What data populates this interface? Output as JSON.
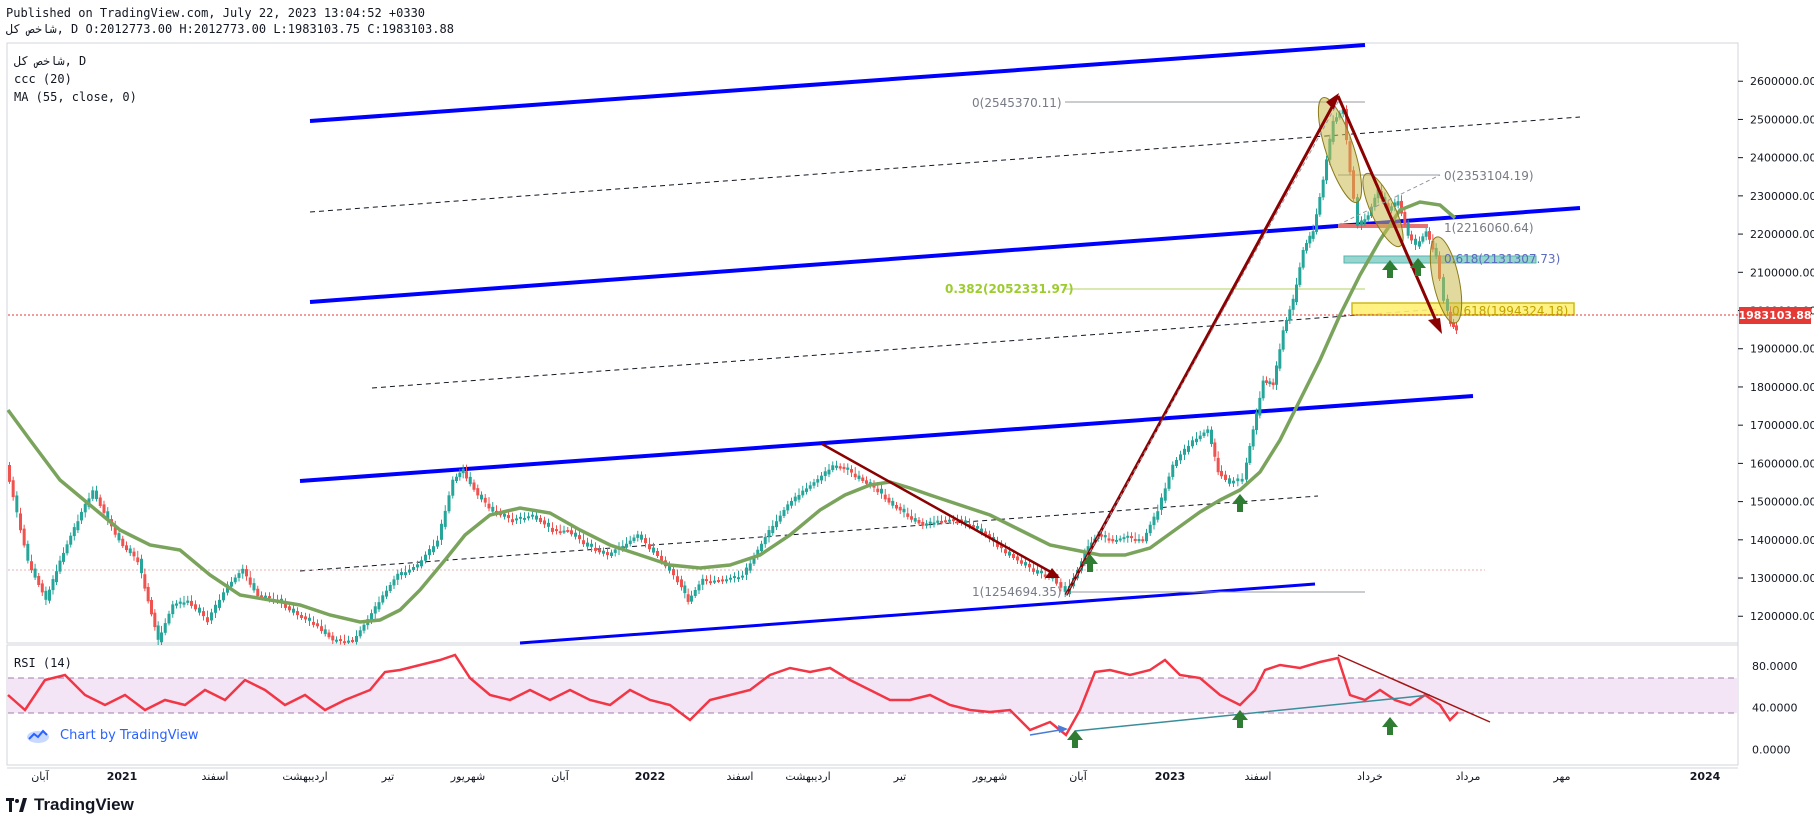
{
  "header": {
    "published": "Published on TradingView.com, July 22, 2023 13:04:52 +0330",
    "ohlc": "شاخص کل, D O:2012773.00 H:2012773.00 L:1983103.75 C:1983103.88"
  },
  "legend": {
    "symbol": "شاخص کل, D",
    "indicator1": "ccc (20)",
    "indicator2": "MA (55, close, 0)"
  },
  "rsi_legend": "RSI (14)",
  "watermark": "Chart by TradingView",
  "brand": "TradingView",
  "colors": {
    "up": "#26a69a",
    "down": "#ef5350",
    "channel": "#0000ff",
    "trend_arrow": "#8b0000",
    "ma": "#7aa35c",
    "rsi": "#f23645",
    "rsi_band": "#f3e5f5",
    "price_tag": "#e53935",
    "arrow_marker": "#2e7d32"
  },
  "chart_data": [
    {
      "type": "candlestick",
      "series": [
        {
          "name": "MA (55, close, 0)",
          "type": "line"
        }
      ],
      "y_ticks": [
        "2600000.00",
        "2500000.00",
        "2400000.00",
        "2300000.00",
        "2200000.00",
        "2100000.00",
        "2000000.00",
        "1900000.00",
        "1800000.00",
        "1700000.00",
        "1600000.00",
        "1500000.00",
        "1400000.00",
        "1300000.00",
        "1200000.00"
      ],
      "y_values": [
        2600000,
        2500000,
        2400000,
        2300000,
        2200000,
        2100000,
        2000000,
        1900000,
        1800000,
        1700000,
        1600000,
        1500000,
        1400000,
        1300000,
        1200000
      ],
      "ylim": [
        1130000,
        2700000
      ],
      "x_ticks": [
        "آبان",
        "2021",
        "اسفند",
        "اردیبهشت",
        "تیر",
        "شهریور",
        "آبان",
        "2022",
        "اسفند",
        "اردیبهشت",
        "تیر",
        "شهریور",
        "آبان",
        "2023",
        "اسفند",
        "خرداد",
        "مرداد",
        "مهر",
        "2024"
      ],
      "bold_x_ticks": [
        "2021",
        "2022",
        "2023",
        "2024"
      ],
      "last_price": "1983103.88",
      "last_price_value": 1983103.88,
      "fib_labels": [
        {
          "text": "0(2545370.11)",
          "value": 2545370.11
        },
        {
          "text": "0(2353104.19)",
          "value": 2353104.19
        },
        {
          "text": "1(2216060.64)",
          "value": 2216060.64
        },
        {
          "text": "0.618(2131307.73)",
          "value": 2131307.73
        },
        {
          "text": "0.382(2052331.97)",
          "value": 2052331.97
        },
        {
          "text": "0.618(1994324.18)",
          "value": 1994324.18
        },
        {
          "text": "1(1254694.35)",
          "value": 1254694.35
        }
      ]
    },
    {
      "type": "line",
      "series": [
        {
          "name": "RSI (14)"
        }
      ],
      "y_ticks": [
        "80.0000",
        "40.0000",
        "0.0000"
      ],
      "y_values": [
        80,
        40,
        0
      ],
      "bands": [
        30,
        70
      ],
      "ylim": [
        -15,
        100
      ]
    }
  ]
}
